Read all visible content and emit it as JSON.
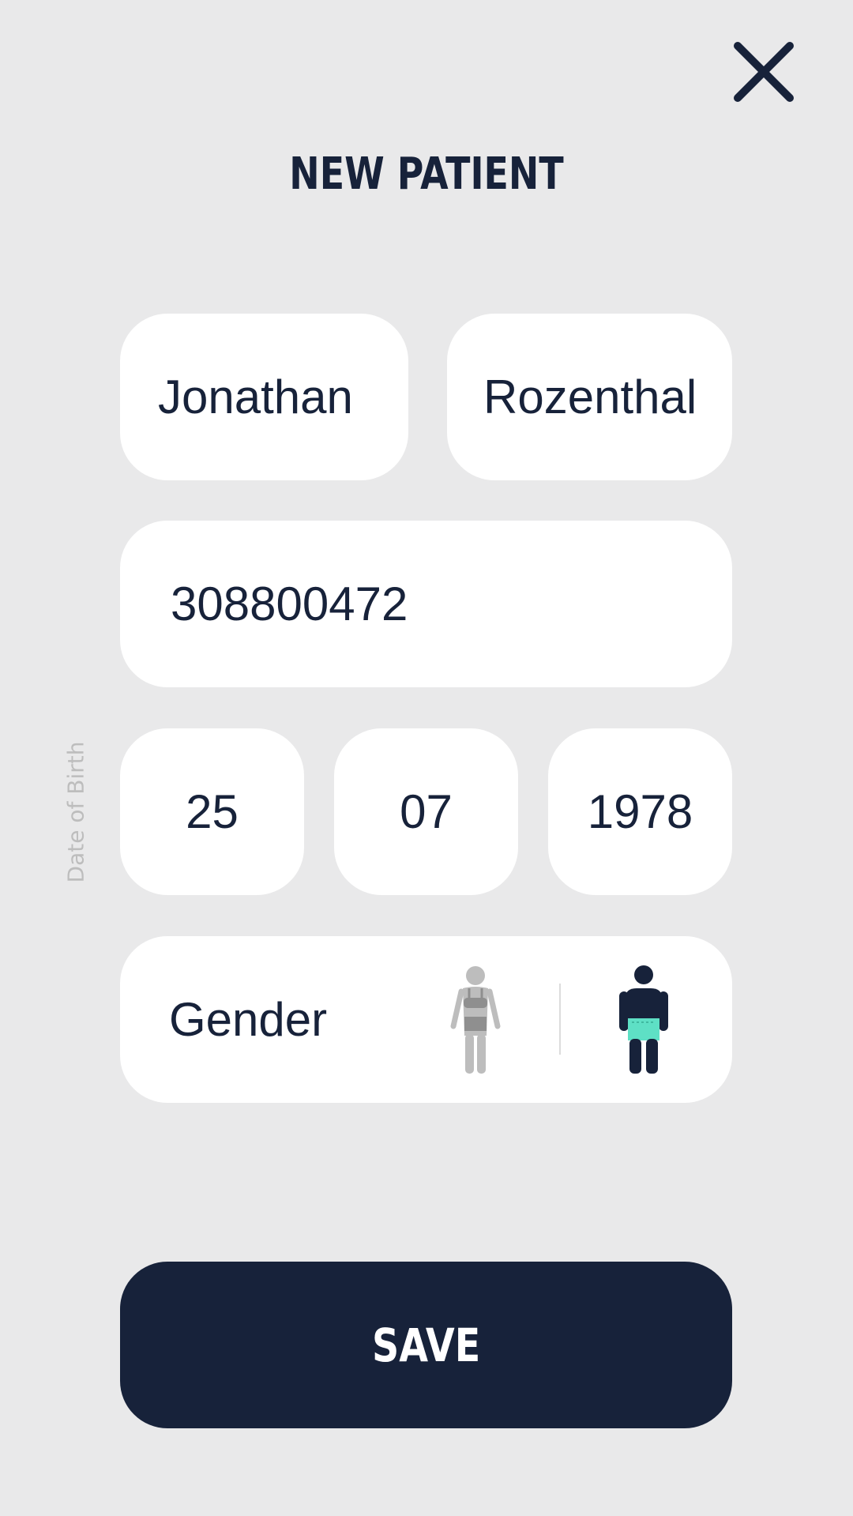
{
  "header": {
    "title": "NEW PATIENT",
    "close_icon": "close-icon"
  },
  "form": {
    "first_name": {
      "value": "Jonathan"
    },
    "last_name": {
      "value": "Rozenthal"
    },
    "id_number": {
      "value": "308800472"
    },
    "date_of_birth": {
      "label": "Date of Birth",
      "day": "25",
      "month": "07",
      "year": "1978"
    },
    "gender": {
      "label": "Gender",
      "female_icon": "female-figure-icon",
      "male_icon": "male-figure-icon",
      "selected": "male"
    }
  },
  "actions": {
    "save_label": "SAVE"
  },
  "colors": {
    "background": "#e9e9ea",
    "primary": "#17223a",
    "field_background": "#ffffff",
    "accent": "#5ee0c5",
    "inactive": "#bdbdbd"
  }
}
